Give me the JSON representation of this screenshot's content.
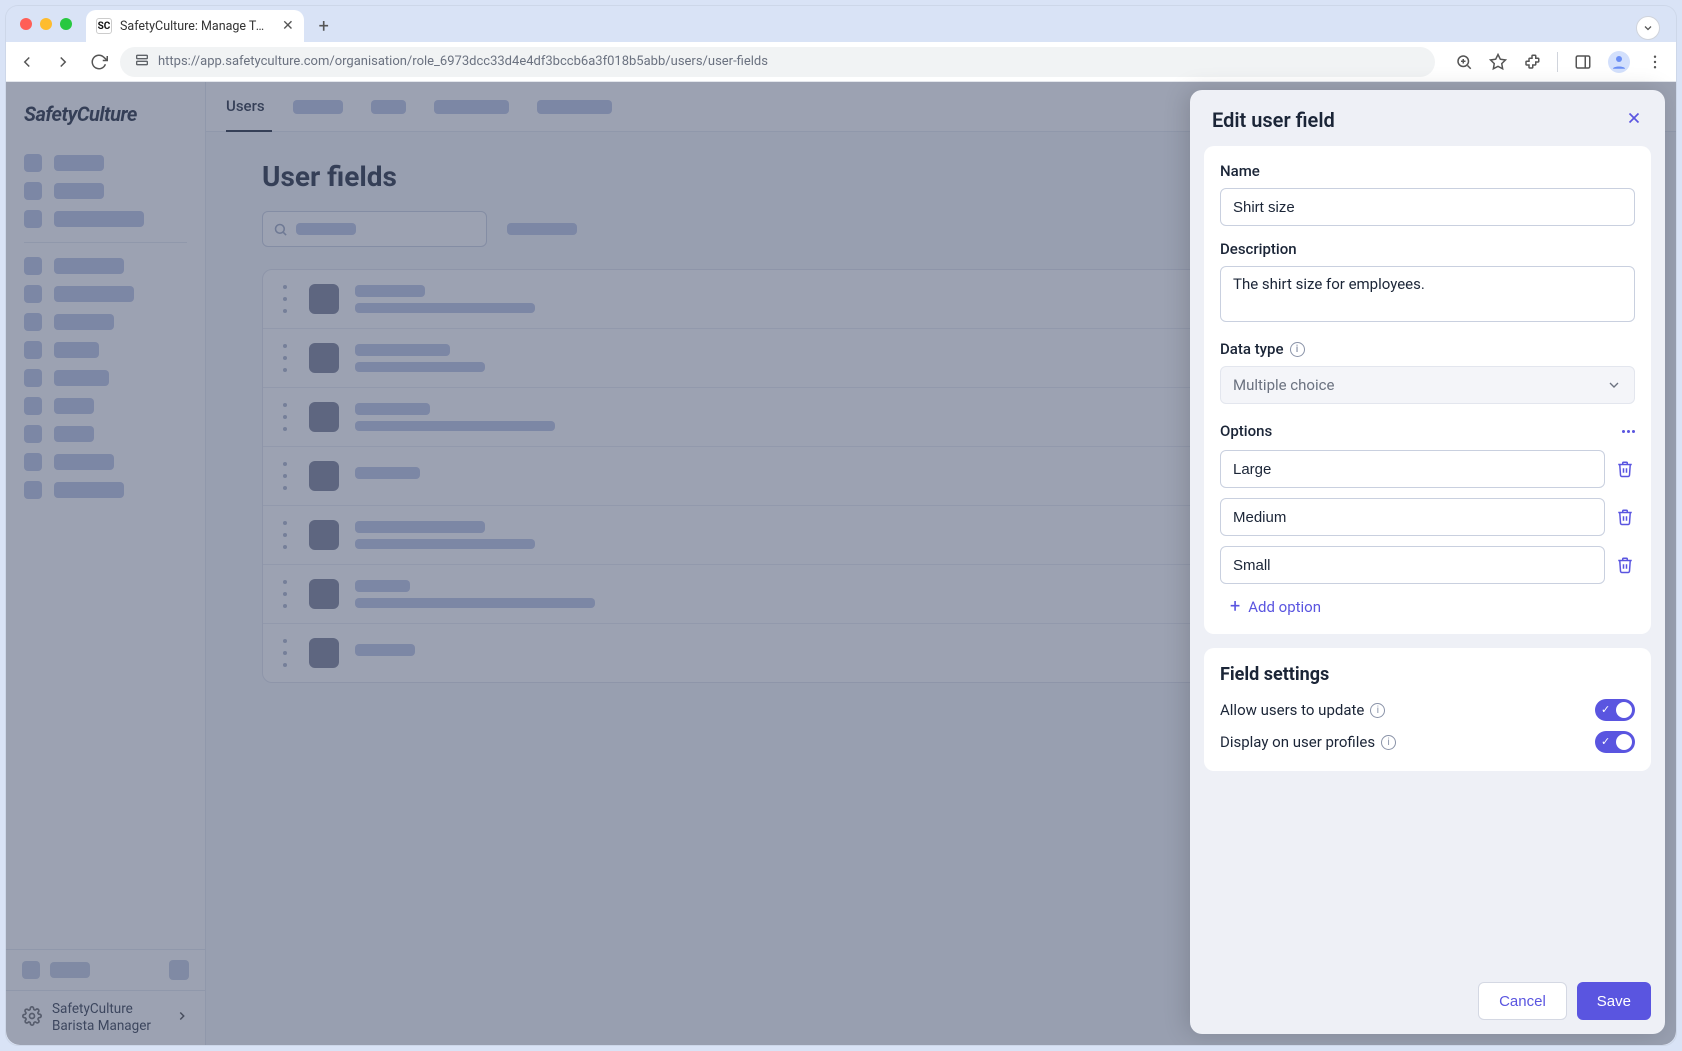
{
  "browser": {
    "tab_title": "SafetyCulture: Manage Teams and...",
    "url": "https://app.safetyculture.com/organisation/role_6973dcc33d4e4df3bccb6a3f018b5abb/users/user-fields",
    "favicon_text": "SC"
  },
  "sidebar": {
    "logo": "SafetyCulture",
    "footer_line1": "SafetyCulture",
    "footer_line2": "Barista Manager"
  },
  "tabs": {
    "active": "Users"
  },
  "page": {
    "title": "User fields"
  },
  "panel": {
    "title": "Edit user field",
    "labels": {
      "name": "Name",
      "description": "Description",
      "data_type": "Data type",
      "options": "Options",
      "add_option": "Add option",
      "field_settings": "Field settings",
      "allow_update": "Allow users to update",
      "display_profiles": "Display on user profiles"
    },
    "values": {
      "name": "Shirt size",
      "description": "The shirt size for employees.",
      "data_type": "Multiple choice"
    },
    "options": [
      "Large",
      "Medium",
      "Small"
    ],
    "buttons": {
      "cancel": "Cancel",
      "save": "Save"
    }
  }
}
